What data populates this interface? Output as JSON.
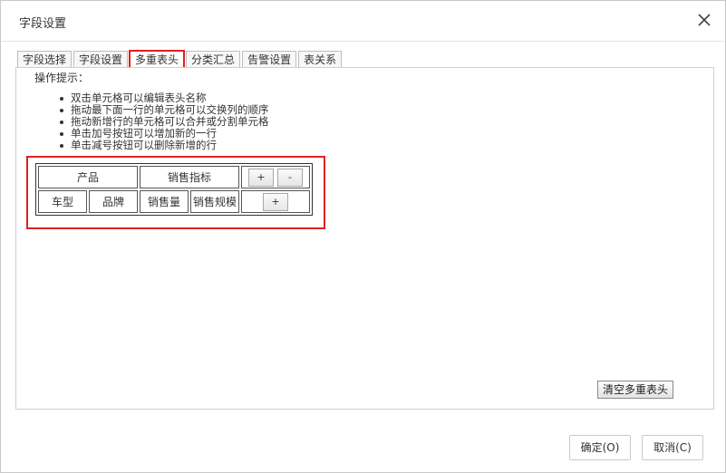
{
  "dialog": {
    "title": "字段设置"
  },
  "tabs": [
    {
      "label": "字段选择"
    },
    {
      "label": "字段设置"
    },
    {
      "label": "多重表头"
    },
    {
      "label": "分类汇总"
    },
    {
      "label": "告警设置"
    },
    {
      "label": "表关系"
    }
  ],
  "panel": {
    "hint_title": "操作提示：",
    "hints": [
      "双击单元格可以编辑表头名称",
      "拖动最下面一行的单元格可以交换列的顺序",
      "拖动新增行的单元格可以合并或分割单元格",
      "单击加号按钮可以增加新的一行",
      "单击减号按钮可以删除新增的行"
    ],
    "header_rows": {
      "row1": [
        "产品",
        "销售指标"
      ],
      "row2": [
        "车型",
        "品牌",
        "销售量",
        "销售规模"
      ]
    },
    "plus": "+",
    "minus": "-",
    "clear_label": "清空多重表头"
  },
  "footer": {
    "ok_label": "确定(O)",
    "cancel_label": "取消(C)"
  }
}
